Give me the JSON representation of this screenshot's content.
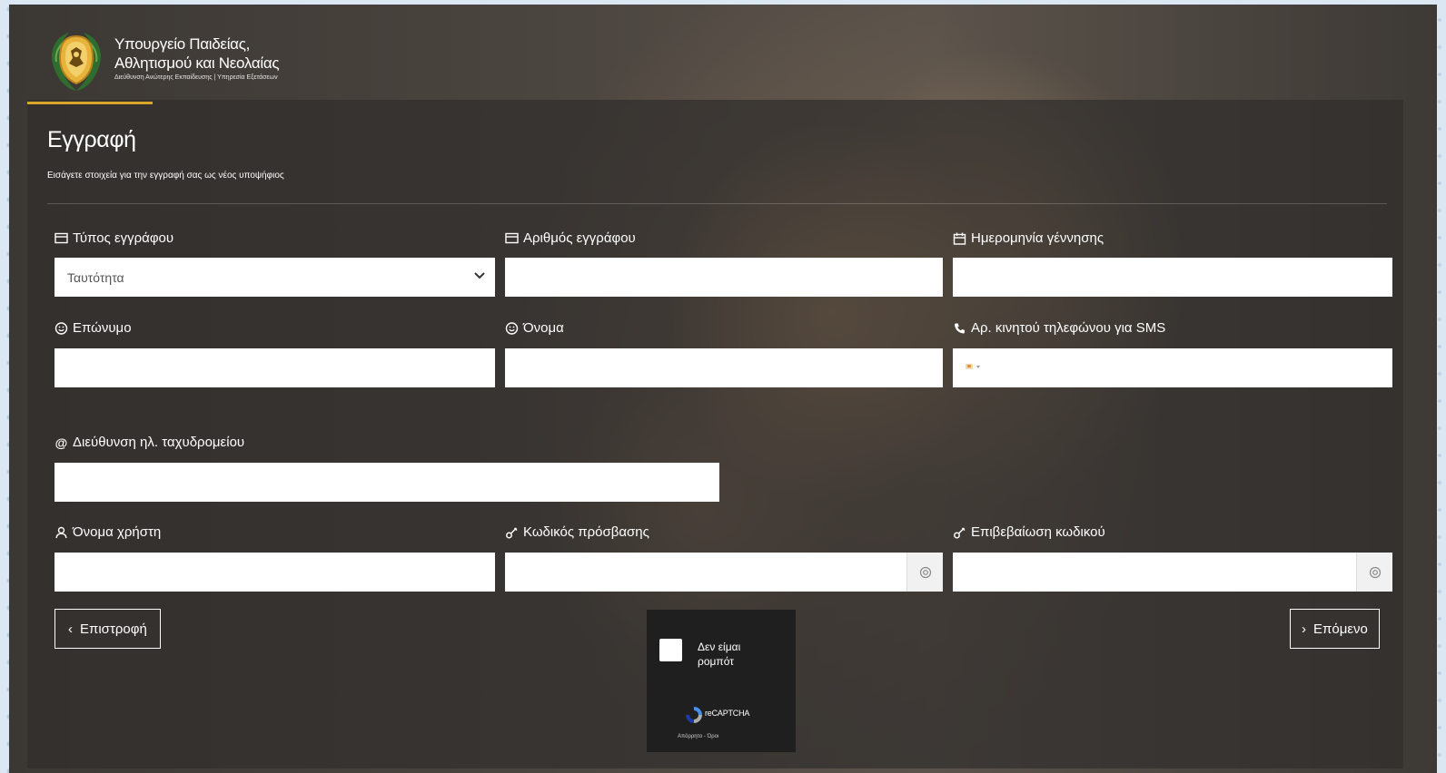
{
  "header": {
    "ministry_line1": "Υπουργείο Παιδείας,",
    "ministry_line2": "Αθλητισμού και Νεολαίας",
    "ministry_line3": "Διεύθυνση Ανώτερης Εκπαίδευσης | Υπηρεσία Εξετάσεων"
  },
  "page": {
    "title": "Εγγραφή",
    "subtitle": "Εισάγετε στοιχεία για την εγγραφή σας ως νέος υποψήφιος"
  },
  "form": {
    "doc_type": {
      "label": "Τύπος εγγράφου",
      "selected": "Ταυτότητα"
    },
    "doc_number": {
      "label": "Αριθμός εγγράφου",
      "value": ""
    },
    "birth_date": {
      "label": "Ημερομηνία γέννησης",
      "value": ""
    },
    "surname": {
      "label": "Επώνυμο",
      "value": ""
    },
    "name": {
      "label": "Όνομα",
      "value": ""
    },
    "mobile": {
      "label": "Αρ. κινητού τηλεφώνου για SMS",
      "value": ""
    },
    "email": {
      "label": "Διεύθυνση ηλ. ταχυδρομείου",
      "value": ""
    },
    "username": {
      "label": "Όνομα χρήστη",
      "value": ""
    },
    "password": {
      "label": "Κωδικός πρόσβασης",
      "value": ""
    },
    "password_confirm": {
      "label": "Επιβεβαίωση κωδικού",
      "value": ""
    }
  },
  "buttons": {
    "back": "Επιστροφή",
    "next": "Επόμενο"
  },
  "captcha": {
    "label_line1": "Δεν είμαι",
    "label_line2": "ρομπότ",
    "brand": "reCAPTCHA",
    "terms": "Απόρρητο - Όροι"
  },
  "icons": {
    "doc_type": "card-icon",
    "doc_number": "card-icon",
    "birth_date": "calendar-icon",
    "surname": "smiley-icon",
    "name": "smiley-icon",
    "mobile": "phone-icon",
    "email": "at-icon",
    "username": "user-icon",
    "password": "key-icon",
    "password_confirm": "key-icon",
    "eye": "eye-icon"
  },
  "colors": {
    "accent": "#d9a629",
    "panel": "#302e2c",
    "captcha_bg": "#1f1f1f"
  }
}
